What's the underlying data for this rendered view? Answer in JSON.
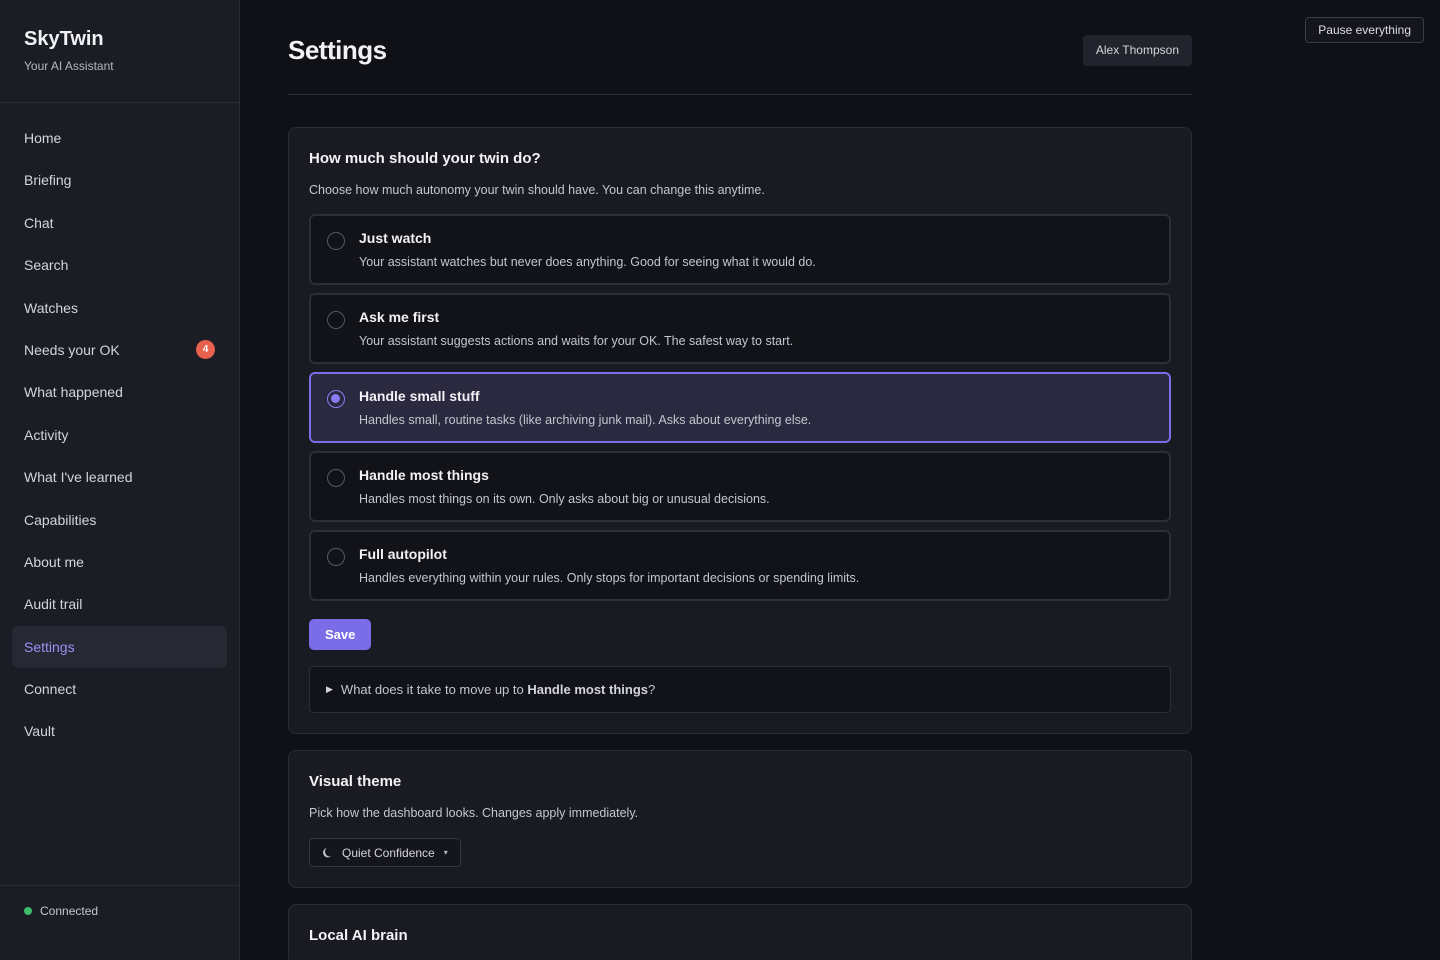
{
  "app": {
    "name": "SkyTwin",
    "tagline": "Your AI Assistant",
    "pause_label": "Pause everything",
    "status": "Connected",
    "status_color": "#3dbb6b",
    "accent_color": "#7b6ce8"
  },
  "sidebar": {
    "items": [
      {
        "label": "Home"
      },
      {
        "label": "Briefing"
      },
      {
        "label": "Chat"
      },
      {
        "label": "Search"
      },
      {
        "label": "Watches"
      },
      {
        "label": "Needs your OK",
        "badge": "4"
      },
      {
        "label": "What happened"
      },
      {
        "label": "Activity"
      },
      {
        "label": "What I've learned"
      },
      {
        "label": "Capabilities"
      },
      {
        "label": "About me"
      },
      {
        "label": "Audit trail"
      },
      {
        "label": "Settings",
        "active": true
      },
      {
        "label": "Connect"
      },
      {
        "label": "Vault"
      }
    ]
  },
  "header": {
    "title": "Settings",
    "user": "Alex Thompson"
  },
  "autonomy": {
    "title": "How much should your twin do?",
    "description": "Choose how much autonomy your twin should have. You can change this anytime.",
    "options": [
      {
        "title": "Just watch",
        "desc": "Your assistant watches but never does anything. Good for seeing what it would do."
      },
      {
        "title": "Ask me first",
        "desc": "Your assistant suggests actions and waits for your OK. The safest way to start."
      },
      {
        "title": "Handle small stuff",
        "desc": "Handles small, routine tasks (like archiving junk mail). Asks about everything else.",
        "selected": true
      },
      {
        "title": "Handle most things",
        "desc": "Handles most things on its own. Only asks about big or unusual decisions."
      },
      {
        "title": "Full autopilot",
        "desc": "Handles everything within your rules. Only stops for important decisions or spending limits."
      }
    ],
    "save_label": "Save",
    "disclosure_prefix": "What does it take to move up to ",
    "disclosure_level": "Handle most things",
    "disclosure_suffix": "?"
  },
  "theme": {
    "title": "Visual theme",
    "description": "Pick how the dashboard looks. Changes apply immediately.",
    "selected": "Quiet Confidence",
    "icon": "moon-icon"
  },
  "local_ai": {
    "title": "Local AI brain"
  }
}
